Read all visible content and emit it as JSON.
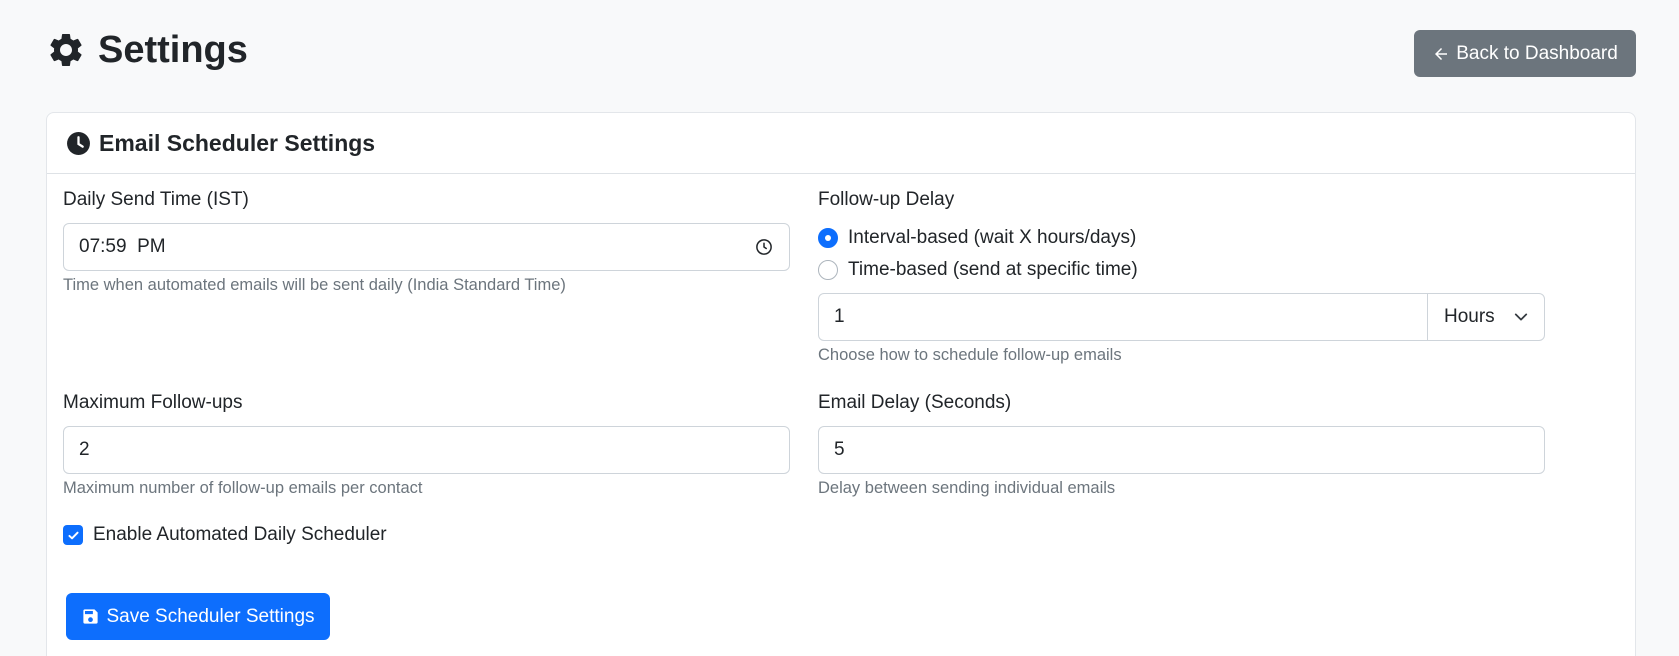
{
  "page": {
    "title": "Settings",
    "back_button": "Back to Dashboard"
  },
  "card": {
    "title": "Email Scheduler Settings"
  },
  "daily_send_time": {
    "label": "Daily Send Time (IST)",
    "value": "07:59  PM",
    "help": "Time when automated emails will be sent daily (India Standard Time)"
  },
  "follow_up_delay": {
    "label": "Follow-up Delay",
    "options": [
      {
        "label": "Interval-based (wait X hours/days)",
        "checked": true
      },
      {
        "label": "Time-based (send at specific time)",
        "checked": false
      }
    ],
    "value": "1",
    "unit": "Hours",
    "help": "Choose how to schedule follow-up emails"
  },
  "max_follow_ups": {
    "label": "Maximum Follow-ups",
    "value": "2",
    "help": "Maximum number of follow-up emails per contact"
  },
  "email_delay": {
    "label": "Email Delay (Seconds)",
    "value": "5",
    "help": "Delay between sending individual emails"
  },
  "enable_scheduler": {
    "label": "Enable Automated Daily Scheduler",
    "checked": true
  },
  "save_button": "Save Scheduler Settings",
  "colors": {
    "primary": "#0d6efd",
    "secondary": "#6c757d",
    "background": "#f8f9fa",
    "muted_text": "#6c757d"
  }
}
